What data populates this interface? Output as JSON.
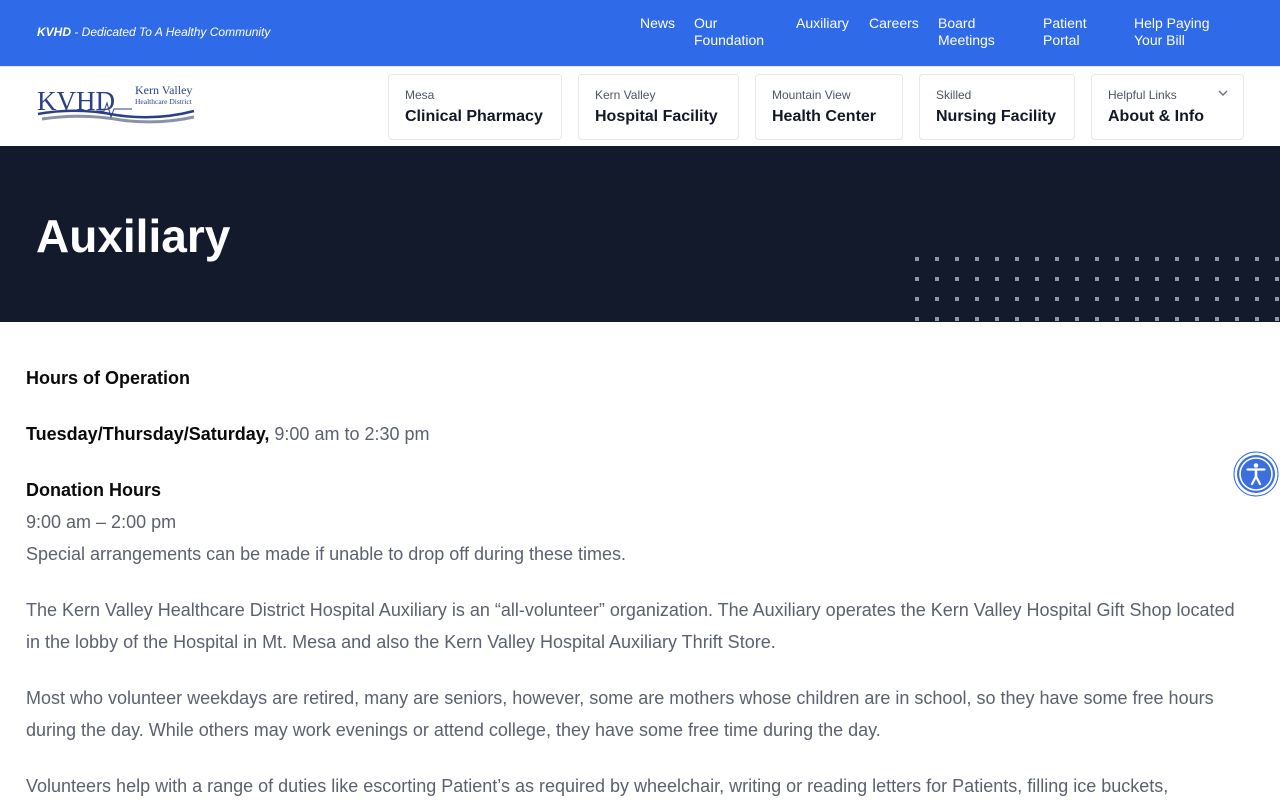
{
  "topbar": {
    "brand": "KVHD",
    "tagline": " - Dedicated To A Healthy Community",
    "nav": [
      {
        "label": "News"
      },
      {
        "label": "Our Foundation"
      },
      {
        "label": "Auxiliary"
      },
      {
        "label": "Careers"
      },
      {
        "label": "Board Meetings"
      },
      {
        "label": "Patient Portal"
      },
      {
        "label": "Help Paying Your Bill"
      }
    ]
  },
  "logo": {
    "letters": "KVHD",
    "line1": "Kern Valley",
    "line2": "Healthcare District"
  },
  "facility_nav": [
    {
      "small": "Mesa",
      "big": "Clinical Pharmacy"
    },
    {
      "small": "Kern Valley",
      "big": "Hospital Facility"
    },
    {
      "small": "Mountain View",
      "big": "Health Center"
    },
    {
      "small": "Skilled",
      "big": "Nursing Facility"
    },
    {
      "small": "Helpful Links",
      "big": "About & Info"
    }
  ],
  "hero": {
    "title": "Auxiliary"
  },
  "content": {
    "hours_heading": "Hours of Operation",
    "days_label": "Tuesday/Thursday/Saturday,",
    "days_time": " 9:00 am to 2:30 pm",
    "donation_heading": "Donation Hours",
    "donation_time": "9:00 am – 2:00 pm",
    "donation_note": "Special arrangements can be made if unable to drop off during these times.",
    "para1": "The Kern Valley Healthcare District Hospital Auxiliary is an “all-volunteer” organization. The Auxiliary operates the Kern Valley Hospital Gift Shop located in the lobby of the Hospital in Mt. Mesa and also the Kern Valley Hospital Auxiliary Thrift Store.",
    "para2": "Most who volunteer weekdays are retired, many are seniors, however, some are mothers whose children are in school, so they have some free hours during the day. While others may work evenings or attend college, they have some free time during the day.",
    "para3": "Volunteers help with a range of duties like escorting Patient’s as required by wheelchair, writing or reading letters for Patients, filling ice buckets,"
  },
  "colors": {
    "topbar": "#2f6ae8",
    "hero": "#131a2b",
    "body_text": "#5b6170",
    "heading_text": "#0a0a0a"
  },
  "icons": {
    "dropdown": "chevron-down-icon",
    "accessibility": "accessibility-icon"
  }
}
